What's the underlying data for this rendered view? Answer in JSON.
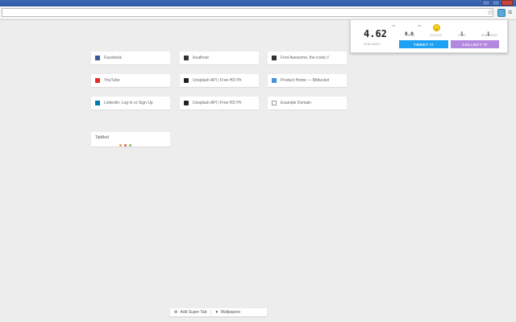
{
  "browser": {
    "icons": {
      "star": "star-icon",
      "extension": "extension-icon",
      "menu": "menu-icon"
    }
  },
  "tiles": [
    {
      "label": "Facebook",
      "icon": "facebook-icon"
    },
    {
      "label": "localhost",
      "icon": "site-icon"
    },
    {
      "label": "Font Awesome, the iconic f",
      "icon": "fontawesome-icon"
    },
    {
      "label": "YouTube",
      "icon": "youtube-icon"
    },
    {
      "label": "Unsplash API | Free HD Ph",
      "icon": "camera-icon"
    },
    {
      "label": "Product Home — Bitbucket",
      "icon": "bitbucket-icon"
    },
    {
      "label": "LinkedIn: Log In or Sign Up",
      "icon": "linkedin-icon"
    },
    {
      "label": "Unsplash API | Free HD Ph",
      "icon": "camera-icon"
    },
    {
      "label": "Example Domain",
      "icon": "document-icon"
    }
  ],
  "tabbed": {
    "title": "TabBed",
    "dot_colors": [
      "#d9a441",
      "#e2574c",
      "#8bc34a"
    ]
  },
  "popup": {
    "available": {
      "value": "4.62",
      "unit": "GB",
      "caption": "AVAILABLE"
    },
    "total": {
      "value": "8.0",
      "unit": "GB",
      "caption": "TOTAL"
    },
    "status": {
      "caption": "STATUS",
      "icon": "smiley-icon"
    },
    "tabs": {
      "value": "1",
      "caption": "TABS"
    },
    "windows": {
      "value": "1",
      "caption": "WINDOWS"
    },
    "tweet_label": "TWEET IT",
    "collect_label": "COLLECT IT",
    "colors": {
      "tweet": "#1da1f2",
      "collect": "#b389e0"
    }
  },
  "bottom": {
    "add_label": "Add Super Tab",
    "wallpapers_label": "Wallpapers",
    "add_icon": "gear-icon",
    "wallpapers_icon": "heart-icon"
  }
}
